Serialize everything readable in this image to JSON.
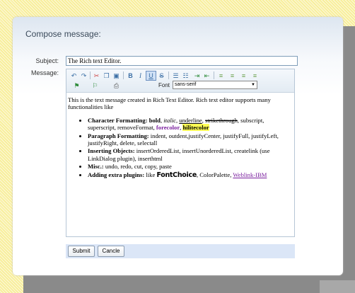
{
  "dialog": {
    "title": "Compose message:"
  },
  "form": {
    "subject_label": "Subject:",
    "subject_value": "The Rich text Editor.",
    "message_label": "Message:"
  },
  "toolbar": {
    "font_label": "Font",
    "font_value": "sans-serif",
    "icons": [
      "undo-icon",
      "redo-icon",
      "cut-icon",
      "copy-icon",
      "paste-icon",
      "bold-icon",
      "italic-icon",
      "underline-icon",
      "strikethrough-icon",
      "ordered-list-icon",
      "unordered-list-icon",
      "indent-icon",
      "outdent-icon",
      "justify-left-icon",
      "justify-center-icon",
      "justify-right-icon",
      "justify-full-icon",
      "insert-link-icon",
      "unlink-icon",
      "print-icon"
    ]
  },
  "content": {
    "intro": "This is the text message created in Rich Text Editor. Rich text editor supports many functionalities like",
    "items": [
      {
        "head": "Character Formatting:",
        "bold": "bold",
        "comma1": ",",
        "italic": "italic",
        "comma2": ",",
        "underline": "underline",
        "comma3": ",",
        "strike": "strikethrough",
        "rest": ", subscript, superscript, removeFormat,",
        "forecolor": "forecolor",
        "comma4": ",",
        "hilitecolor": "hilitecolor"
      },
      {
        "head": "Paragraph Formatting:",
        "text": "indent, outdent,justifyCenter, justifyFull, justifyLeft, justifyRight, delete, selectall"
      },
      {
        "head": "Inserting Objects:",
        "text": "insertOrderedList, insertUnorderedList, createlink (use LinkDialog plugin), inserthtml"
      },
      {
        "head": "Misc.:",
        "text": "undo, redo, cut, copy, paste"
      },
      {
        "head": "Adding extra plugins:",
        "like": "like",
        "fontchoice": "FontChoice",
        "palette": ", ColorPalette,",
        "weblink": "Weblink-IBM"
      }
    ]
  },
  "buttons": {
    "submit": "Submit",
    "cancel": "Cancle"
  }
}
